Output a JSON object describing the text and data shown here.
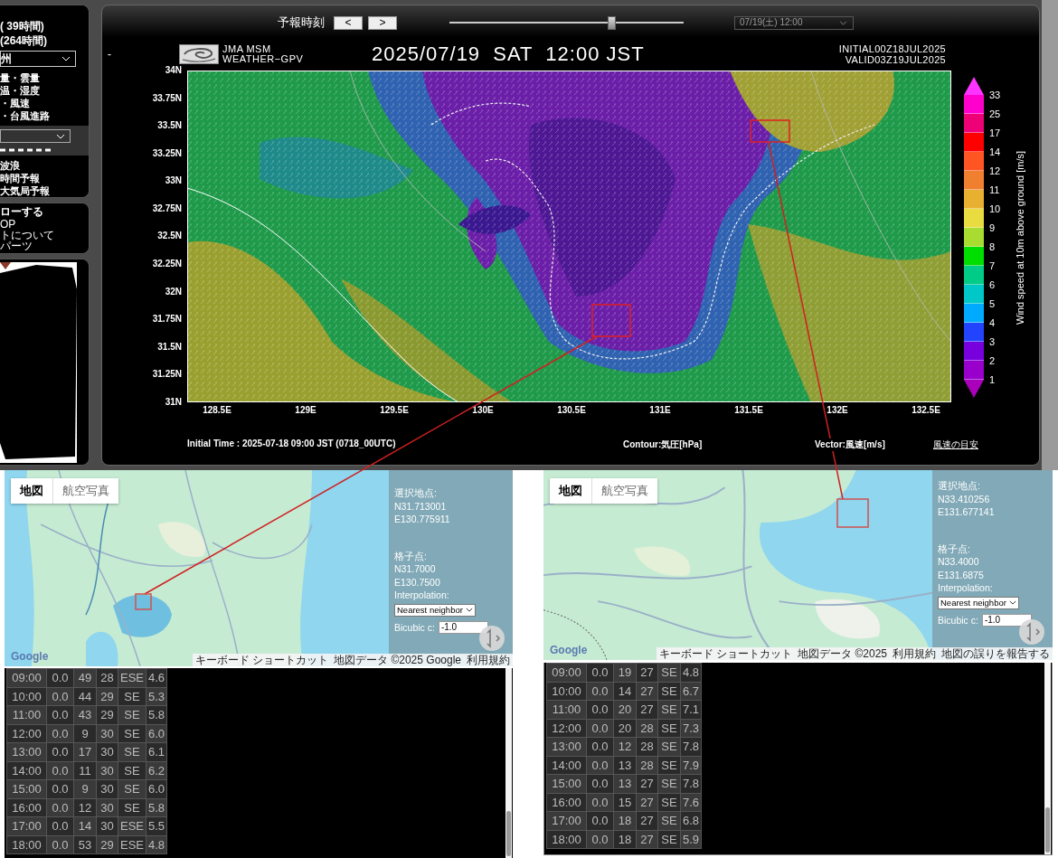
{
  "sidebar": {
    "ranges": [
      "( 39時間)",
      "(264時間)"
    ],
    "region_select": "州",
    "elements": [
      "量・雲量",
      "温・湿度",
      "・風速",
      "・台風進路"
    ],
    "links": [
      "波浪",
      "時間予報",
      "大気局予報"
    ],
    "follow": {
      "title": "ローする",
      "links": [
        "OP",
        "トについて",
        "パーツ"
      ]
    }
  },
  "forecast_bar": {
    "label": "予報時刻",
    "prev": "<",
    "next": ">",
    "slider": {
      "level": 0.69
    },
    "time_select": "07/19(土) 12:00"
  },
  "chart_header": {
    "dash": "-",
    "model": "JMA MSM",
    "product": "WEATHER−GPV",
    "title": "2025/07/19  SAT  12:00 JST",
    "initial": "INITIAL00Z18JUL2025",
    "valid": "VALID03Z19JUL2025"
  },
  "map": {
    "y_ticks": [
      "34N",
      "33.75N",
      "33.5N",
      "33.25N",
      "33N",
      "32.75N",
      "32.5N",
      "32.25N",
      "32N",
      "31.75N",
      "31.5N",
      "31.25N",
      "31N"
    ],
    "x_ticks": [
      "128.5E",
      "129E",
      "129.5E",
      "130E",
      "130.5E",
      "131E",
      "131.5E",
      "132E",
      "132.5E"
    ]
  },
  "legend": {
    "title": "Wind speed at 10m above ground [m/s]",
    "ticks": [
      "33",
      "25",
      "17",
      "14",
      "12",
      "11",
      "10",
      "9",
      "8",
      "7",
      "6",
      "5",
      "4",
      "3",
      "2",
      "1"
    ],
    "bands": [
      {
        "kind": "arrow",
        "color": "#ff33ff"
      },
      {
        "kind": "band",
        "color": "#ff00cc"
      },
      {
        "kind": "band",
        "color": "#ee0077"
      },
      {
        "kind": "band",
        "color": "#ff0000"
      },
      {
        "kind": "band",
        "color": "#ff5522"
      },
      {
        "kind": "band",
        "color": "#f08030"
      },
      {
        "kind": "band",
        "color": "#e8b030"
      },
      {
        "kind": "band",
        "color": "#e8dc40"
      },
      {
        "kind": "band",
        "color": "#a8dc30"
      },
      {
        "kind": "band",
        "color": "#00dd00"
      },
      {
        "kind": "band",
        "color": "#00cc88"
      },
      {
        "kind": "band",
        "color": "#00c8c8"
      },
      {
        "kind": "band",
        "color": "#00aaff"
      },
      {
        "kind": "band",
        "color": "#2244ff"
      },
      {
        "kind": "band",
        "color": "#7700dd"
      },
      {
        "kind": "band",
        "color": "#9900cc"
      },
      {
        "kind": "arrow",
        "color": "#aa00bb"
      }
    ]
  },
  "chart_footer": {
    "initial_time": "Initial Time : 2025-07-18 09:00 JST (0718_00UTC)",
    "contour": "Contour:気圧[hPa]",
    "vector": "Vector:風速[m/s]",
    "guide_link": "風速の目安"
  },
  "points": [
    {
      "map_tabs": [
        {
          "label": "地図",
          "selected": true
        },
        {
          "label": "航空写真",
          "selected": false
        }
      ],
      "selected_label": "選択地点:",
      "selected_lat": "N31.713001",
      "selected_lon": "E130.775911",
      "grid_label": "格子点:",
      "grid_lat": "N31.7000",
      "grid_lon": "E130.7500",
      "interpolation_label": "Interpolation:",
      "interpolation": "Nearest neighbor",
      "bicubic_label": "Bicubic c:",
      "bicubic": "-1.0",
      "logo": "Google",
      "attribution": [
        "キーボード ショートカット",
        "地図データ ©2025 Google",
        "利用規約"
      ],
      "rows": [
        [
          "09:00",
          "0.0",
          "49",
          "28",
          "ESE",
          "4.6"
        ],
        [
          "10:00",
          "0.0",
          "44",
          "29",
          "SE",
          "5.3"
        ],
        [
          "11:00",
          "0.0",
          "43",
          "29",
          "SE",
          "5.8"
        ],
        [
          "12:00",
          "0.0",
          "9",
          "30",
          "SE",
          "6.0"
        ],
        [
          "13:00",
          "0.0",
          "17",
          "30",
          "SE",
          "6.1"
        ],
        [
          "14:00",
          "0.0",
          "11",
          "30",
          "SE",
          "6.2"
        ],
        [
          "15:00",
          "0.0",
          "9",
          "30",
          "SE",
          "6.0"
        ],
        [
          "16:00",
          "0.0",
          "12",
          "30",
          "SE",
          "5.8"
        ],
        [
          "17:00",
          "0.0",
          "14",
          "30",
          "ESE",
          "5.5"
        ],
        [
          "18:00",
          "0.0",
          "53",
          "29",
          "ESE",
          "4.8"
        ]
      ]
    },
    {
      "map_tabs": [
        {
          "label": "地図",
          "selected": true
        },
        {
          "label": "航空写真",
          "selected": false
        }
      ],
      "selected_label": "選択地点:",
      "selected_lat": "N33.410256",
      "selected_lon": "E131.677141",
      "grid_label": "格子点:",
      "grid_lat": "N33.4000",
      "grid_lon": "E131.6875",
      "interpolation_label": "Interpolation:",
      "interpolation": "Nearest neighbor",
      "bicubic_label": "Bicubic c:",
      "bicubic": "-1.0",
      "logo": "Google",
      "attribution": [
        "キーボード ショートカット",
        "地図データ ©2025",
        "利用規約",
        "地図の誤りを報告する"
      ],
      "rows": [
        [
          "09:00",
          "0.0",
          "19",
          "27",
          "SE",
          "4.8"
        ],
        [
          "10:00",
          "0.0",
          "14",
          "27",
          "SE",
          "6.7"
        ],
        [
          "11:00",
          "0.0",
          "20",
          "27",
          "SE",
          "7.1"
        ],
        [
          "12:00",
          "0.0",
          "20",
          "28",
          "SE",
          "7.3"
        ],
        [
          "13:00",
          "0.0",
          "12",
          "28",
          "SE",
          "7.8"
        ],
        [
          "14:00",
          "0.0",
          "13",
          "28",
          "SE",
          "7.9"
        ],
        [
          "15:00",
          "0.0",
          "13",
          "27",
          "SE",
          "7.8"
        ],
        [
          "16:00",
          "0.0",
          "15",
          "27",
          "SE",
          "7.6"
        ],
        [
          "17:00",
          "0.0",
          "18",
          "27",
          "SE",
          "6.8"
        ],
        [
          "18:00",
          "0.0",
          "18",
          "27",
          "SE",
          "5.9"
        ]
      ]
    }
  ]
}
